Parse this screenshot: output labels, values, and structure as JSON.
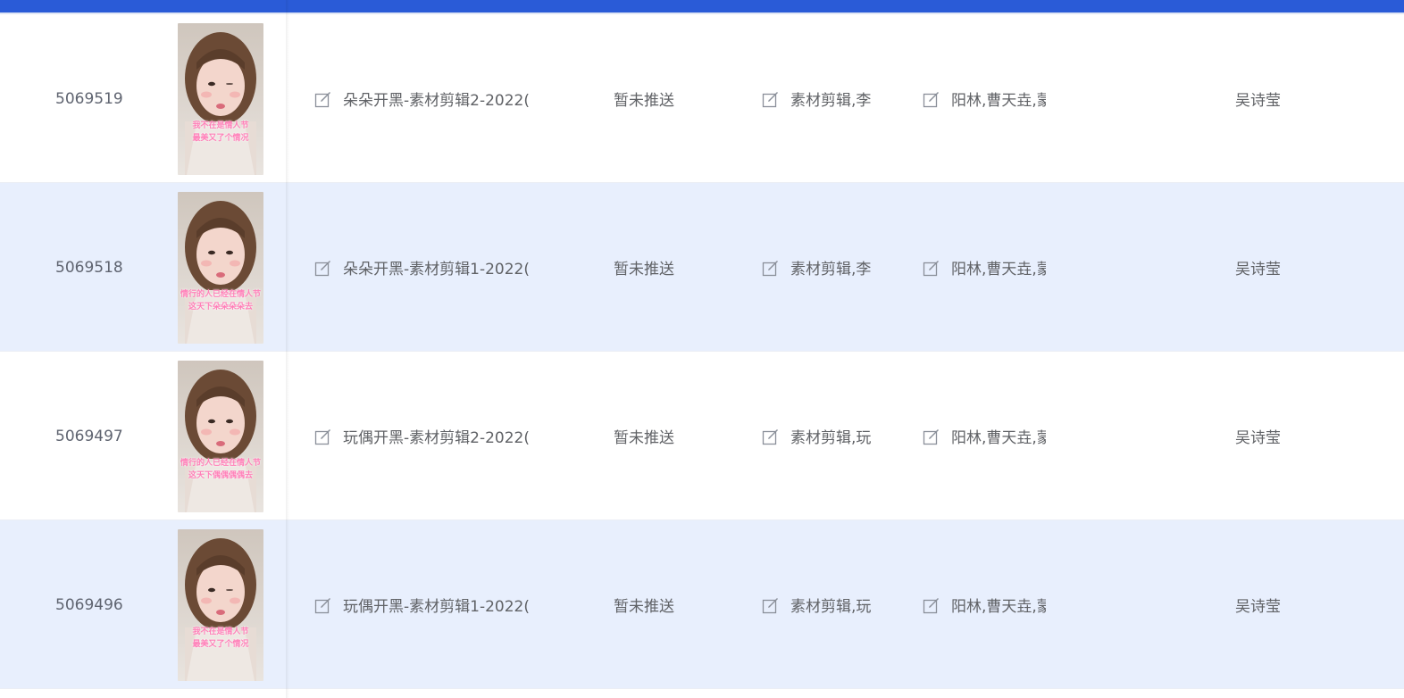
{
  "rows": [
    {
      "id": "5069519",
      "title": "朵朵开黑-素材剪辑2-2022(",
      "status": "暂未推送",
      "tags": "素材剪辑,李",
      "people": "阳林,曹天垚,蒙",
      "owner": "吴诗莹",
      "thumb": {
        "cap1": "我不在是情人节",
        "cap2": "最美又了个情况",
        "variant": "wink"
      }
    },
    {
      "id": "5069518",
      "title": "朵朵开黑-素材剪辑1-2022(",
      "status": "暂未推送",
      "tags": "素材剪辑,李",
      "people": "阳林,曹天垚,蒙",
      "owner": "吴诗莹",
      "thumb": {
        "cap1": "情行的人已经在情人节",
        "cap2": "这天下朵朵朵朵去",
        "variant": "calm"
      }
    },
    {
      "id": "5069497",
      "title": "玩偶开黑-素材剪辑2-2022(",
      "status": "暂未推送",
      "tags": "素材剪辑,玩",
      "people": "阳林,曹天垚,蒙",
      "owner": "吴诗莹",
      "thumb": {
        "cap1": "情行的人已经在情人节",
        "cap2": "这天下偶偶偶偶去",
        "variant": "calm"
      }
    },
    {
      "id": "5069496",
      "title": "玩偶开黑-素材剪辑1-2022(",
      "status": "暂未推送",
      "tags": "素材剪辑,玩",
      "people": "阳林,曹天垚,蒙",
      "owner": "吴诗莹",
      "thumb": {
        "cap1": "我不在是情人节",
        "cap2": "最美又了个情况",
        "variant": "wink"
      }
    }
  ],
  "icons": {
    "edit": "edit-icon"
  },
  "colors": {
    "accent": "#2a5bd7",
    "row_alt": "#e8effd",
    "text": "#606266"
  }
}
